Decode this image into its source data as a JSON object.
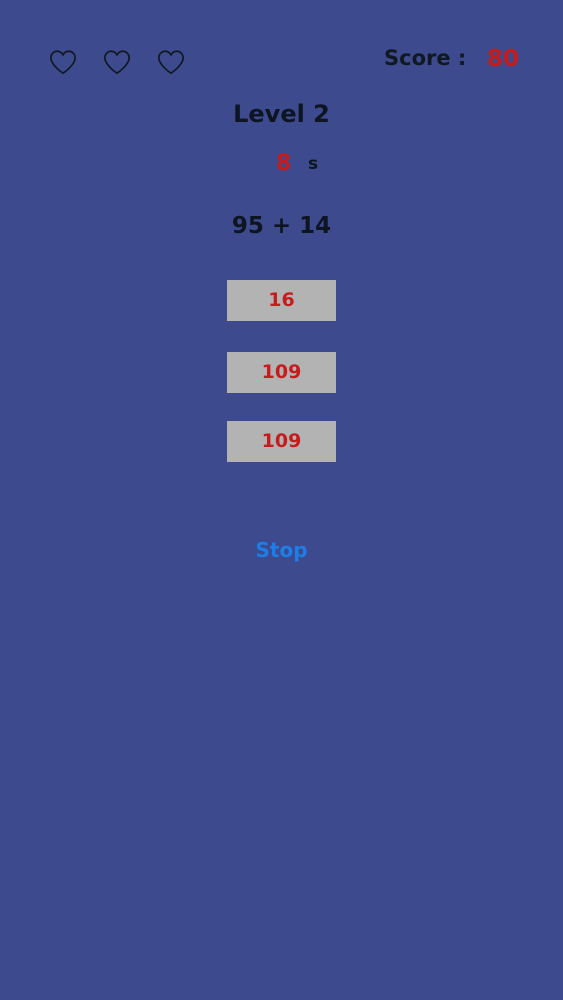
{
  "hud": {
    "lives": [
      {
        "icon": "heart-outline-icon"
      },
      {
        "icon": "heart-outline-icon"
      },
      {
        "icon": "heart-outline-icon"
      }
    ],
    "score_label": "Score :",
    "score_value": "80"
  },
  "game": {
    "level": "Level 2",
    "timer_value": "8",
    "timer_unit": "s",
    "question": "95 + 14",
    "answers": [
      "16",
      "109",
      "109"
    ],
    "stop_label": "Stop"
  },
  "colors": {
    "background": "#3d4a8e",
    "accent_red": "#c71c1c",
    "link_blue": "#1f7de8",
    "button_gray": "#b3b3b3"
  }
}
